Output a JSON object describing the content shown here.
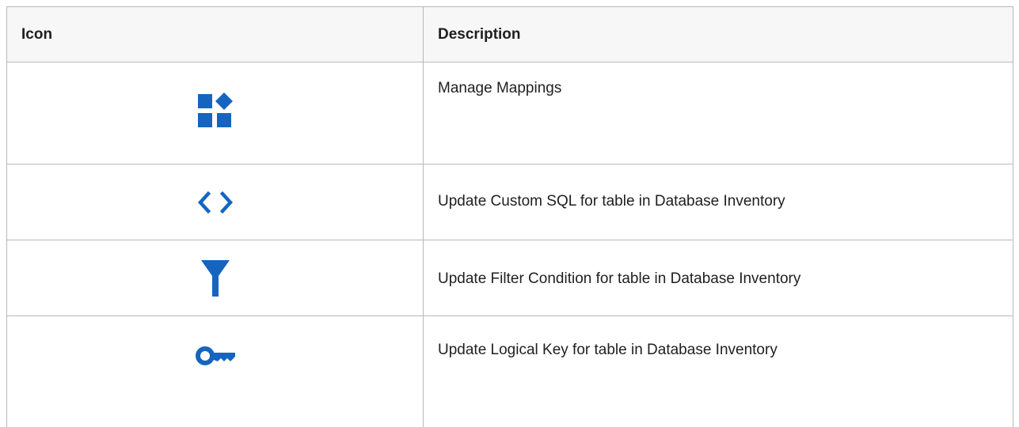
{
  "table": {
    "headers": {
      "icon": "Icon",
      "description": "Description"
    },
    "rows": [
      {
        "icon": "manage-mappings-icon",
        "description": "Manage Mappings"
      },
      {
        "icon": "code-icon",
        "description": "Update Custom SQL for table in Database Inventory"
      },
      {
        "icon": "filter-icon",
        "description": "Update Filter Condition for table in Database Inventory"
      },
      {
        "icon": "key-icon",
        "description": "Update Logical Key for table in Database Inventory"
      }
    ]
  },
  "colors": {
    "icon_blue": "#1565c0",
    "border": "#b8b8b8",
    "header_bg": "#f7f7f7"
  }
}
